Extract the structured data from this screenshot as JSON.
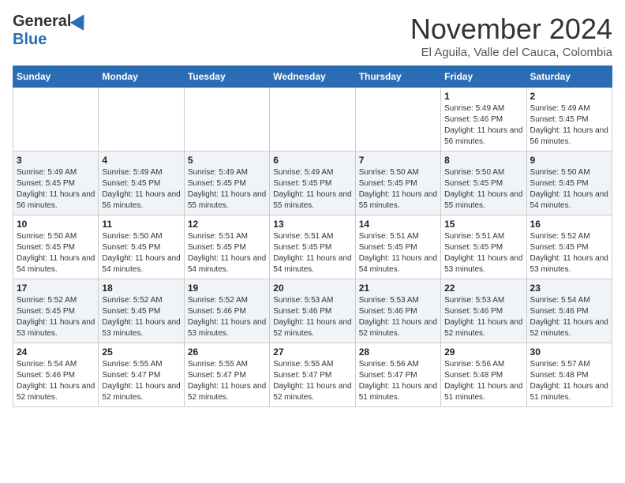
{
  "logo": {
    "general": "General",
    "blue": "Blue"
  },
  "header": {
    "month_title": "November 2024",
    "location": "El Aguila, Valle del Cauca, Colombia"
  },
  "weekdays": [
    "Sunday",
    "Monday",
    "Tuesday",
    "Wednesday",
    "Thursday",
    "Friday",
    "Saturday"
  ],
  "weeks": [
    [
      {
        "day": "",
        "sunrise": "",
        "sunset": "",
        "daylight": ""
      },
      {
        "day": "",
        "sunrise": "",
        "sunset": "",
        "daylight": ""
      },
      {
        "day": "",
        "sunrise": "",
        "sunset": "",
        "daylight": ""
      },
      {
        "day": "",
        "sunrise": "",
        "sunset": "",
        "daylight": ""
      },
      {
        "day": "",
        "sunrise": "",
        "sunset": "",
        "daylight": ""
      },
      {
        "day": "1",
        "sunrise": "Sunrise: 5:49 AM",
        "sunset": "Sunset: 5:46 PM",
        "daylight": "Daylight: 11 hours and 56 minutes."
      },
      {
        "day": "2",
        "sunrise": "Sunrise: 5:49 AM",
        "sunset": "Sunset: 5:45 PM",
        "daylight": "Daylight: 11 hours and 56 minutes."
      }
    ],
    [
      {
        "day": "3",
        "sunrise": "Sunrise: 5:49 AM",
        "sunset": "Sunset: 5:45 PM",
        "daylight": "Daylight: 11 hours and 56 minutes."
      },
      {
        "day": "4",
        "sunrise": "Sunrise: 5:49 AM",
        "sunset": "Sunset: 5:45 PM",
        "daylight": "Daylight: 11 hours and 56 minutes."
      },
      {
        "day": "5",
        "sunrise": "Sunrise: 5:49 AM",
        "sunset": "Sunset: 5:45 PM",
        "daylight": "Daylight: 11 hours and 55 minutes."
      },
      {
        "day": "6",
        "sunrise": "Sunrise: 5:49 AM",
        "sunset": "Sunset: 5:45 PM",
        "daylight": "Daylight: 11 hours and 55 minutes."
      },
      {
        "day": "7",
        "sunrise": "Sunrise: 5:50 AM",
        "sunset": "Sunset: 5:45 PM",
        "daylight": "Daylight: 11 hours and 55 minutes."
      },
      {
        "day": "8",
        "sunrise": "Sunrise: 5:50 AM",
        "sunset": "Sunset: 5:45 PM",
        "daylight": "Daylight: 11 hours and 55 minutes."
      },
      {
        "day": "9",
        "sunrise": "Sunrise: 5:50 AM",
        "sunset": "Sunset: 5:45 PM",
        "daylight": "Daylight: 11 hours and 54 minutes."
      }
    ],
    [
      {
        "day": "10",
        "sunrise": "Sunrise: 5:50 AM",
        "sunset": "Sunset: 5:45 PM",
        "daylight": "Daylight: 11 hours and 54 minutes."
      },
      {
        "day": "11",
        "sunrise": "Sunrise: 5:50 AM",
        "sunset": "Sunset: 5:45 PM",
        "daylight": "Daylight: 11 hours and 54 minutes."
      },
      {
        "day": "12",
        "sunrise": "Sunrise: 5:51 AM",
        "sunset": "Sunset: 5:45 PM",
        "daylight": "Daylight: 11 hours and 54 minutes."
      },
      {
        "day": "13",
        "sunrise": "Sunrise: 5:51 AM",
        "sunset": "Sunset: 5:45 PM",
        "daylight": "Daylight: 11 hours and 54 minutes."
      },
      {
        "day": "14",
        "sunrise": "Sunrise: 5:51 AM",
        "sunset": "Sunset: 5:45 PM",
        "daylight": "Daylight: 11 hours and 54 minutes."
      },
      {
        "day": "15",
        "sunrise": "Sunrise: 5:51 AM",
        "sunset": "Sunset: 5:45 PM",
        "daylight": "Daylight: 11 hours and 53 minutes."
      },
      {
        "day": "16",
        "sunrise": "Sunrise: 5:52 AM",
        "sunset": "Sunset: 5:45 PM",
        "daylight": "Daylight: 11 hours and 53 minutes."
      }
    ],
    [
      {
        "day": "17",
        "sunrise": "Sunrise: 5:52 AM",
        "sunset": "Sunset: 5:45 PM",
        "daylight": "Daylight: 11 hours and 53 minutes."
      },
      {
        "day": "18",
        "sunrise": "Sunrise: 5:52 AM",
        "sunset": "Sunset: 5:45 PM",
        "daylight": "Daylight: 11 hours and 53 minutes."
      },
      {
        "day": "19",
        "sunrise": "Sunrise: 5:52 AM",
        "sunset": "Sunset: 5:46 PM",
        "daylight": "Daylight: 11 hours and 53 minutes."
      },
      {
        "day": "20",
        "sunrise": "Sunrise: 5:53 AM",
        "sunset": "Sunset: 5:46 PM",
        "daylight": "Daylight: 11 hours and 52 minutes."
      },
      {
        "day": "21",
        "sunrise": "Sunrise: 5:53 AM",
        "sunset": "Sunset: 5:46 PM",
        "daylight": "Daylight: 11 hours and 52 minutes."
      },
      {
        "day": "22",
        "sunrise": "Sunrise: 5:53 AM",
        "sunset": "Sunset: 5:46 PM",
        "daylight": "Daylight: 11 hours and 52 minutes."
      },
      {
        "day": "23",
        "sunrise": "Sunrise: 5:54 AM",
        "sunset": "Sunset: 5:46 PM",
        "daylight": "Daylight: 11 hours and 52 minutes."
      }
    ],
    [
      {
        "day": "24",
        "sunrise": "Sunrise: 5:54 AM",
        "sunset": "Sunset: 5:46 PM",
        "daylight": "Daylight: 11 hours and 52 minutes."
      },
      {
        "day": "25",
        "sunrise": "Sunrise: 5:55 AM",
        "sunset": "Sunset: 5:47 PM",
        "daylight": "Daylight: 11 hours and 52 minutes."
      },
      {
        "day": "26",
        "sunrise": "Sunrise: 5:55 AM",
        "sunset": "Sunset: 5:47 PM",
        "daylight": "Daylight: 11 hours and 52 minutes."
      },
      {
        "day": "27",
        "sunrise": "Sunrise: 5:55 AM",
        "sunset": "Sunset: 5:47 PM",
        "daylight": "Daylight: 11 hours and 52 minutes."
      },
      {
        "day": "28",
        "sunrise": "Sunrise: 5:56 AM",
        "sunset": "Sunset: 5:47 PM",
        "daylight": "Daylight: 11 hours and 51 minutes."
      },
      {
        "day": "29",
        "sunrise": "Sunrise: 5:56 AM",
        "sunset": "Sunset: 5:48 PM",
        "daylight": "Daylight: 11 hours and 51 minutes."
      },
      {
        "day": "30",
        "sunrise": "Sunrise: 5:57 AM",
        "sunset": "Sunset: 5:48 PM",
        "daylight": "Daylight: 11 hours and 51 minutes."
      }
    ]
  ]
}
